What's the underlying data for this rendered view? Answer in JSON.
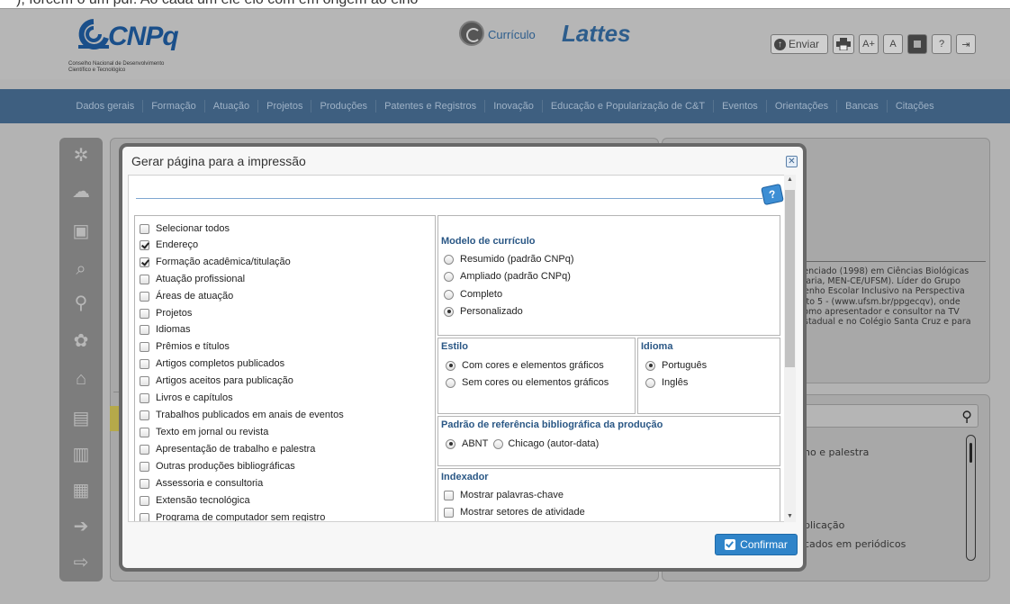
{
  "top_strip_text": "), forcem o um pdf: Ao cada um ele elo com em origem ao elno",
  "header": {
    "brand": "CNPq",
    "brand_sub1": "Conselho Nacional de Desenvolvimento",
    "brand_sub2": "Científico e Tecnológico",
    "lattes_prefix": "Currículo",
    "lattes_main": "Lattes",
    "toolbar": {
      "send_label": "Enviar",
      "font_increase": "A+",
      "font_normal": "A",
      "help": "?"
    }
  },
  "nav": [
    "Dados gerais",
    "Formação",
    "Atuação",
    "Projetos",
    "Produções",
    "Patentes e Registros",
    "Inovação",
    "Educação e Popularização de C&T",
    "Eventos",
    "Orientações",
    "Bancas",
    "Citações"
  ],
  "background": {
    "bio_lines": [
      "cenciado (1998) em Ciências Biológicas",
      " Maria, MEN-CE/UFSM). Líder do Grupo",
      "penho Escolar Inclusivo na Perspectiva",
      "eito 5 - (www.ufsm.br/ppgecqv), onde",
      " como apresentador e consultor na TV",
      "Estadual e no Colégio Santa Cruz e para"
    ],
    "list": [
      "ho e palestra",
      "blicação",
      "cados em periódicos"
    ]
  },
  "modal": {
    "title": "Gerar página para a impressão",
    "sections_list": [
      {
        "label": "Selecionar todos",
        "checked": false
      },
      {
        "label": "Endereço",
        "checked": true
      },
      {
        "label": "Formação acadêmica/titulação",
        "checked": true
      },
      {
        "label": "Atuação profissional",
        "checked": false
      },
      {
        "label": "Áreas de atuação",
        "checked": false
      },
      {
        "label": "Projetos",
        "checked": false
      },
      {
        "label": "Idiomas",
        "checked": false
      },
      {
        "label": "Prêmios e títulos",
        "checked": false
      },
      {
        "label": "Artigos completos publicados",
        "checked": false
      },
      {
        "label": "Artigos aceitos para publicação",
        "checked": false
      },
      {
        "label": "Livros e capítulos",
        "checked": false
      },
      {
        "label": "Trabalhos publicados em anais de eventos",
        "checked": false
      },
      {
        "label": "Texto em jornal ou revista",
        "checked": false
      },
      {
        "label": "Apresentação de trabalho e palestra",
        "checked": false
      },
      {
        "label": "Outras produções bibliográficas",
        "checked": false
      },
      {
        "label": "Assessoria e consultoria",
        "checked": false
      },
      {
        "label": "Extensão tecnológica",
        "checked": false
      },
      {
        "label": "Programa de computador sem registro",
        "checked": false
      }
    ],
    "modelo": {
      "title": "Modelo de currículo",
      "options": [
        "Resumido (padrão CNPq)",
        "Ampliado (padrão CNPq)",
        "Completo",
        "Personalizado"
      ],
      "selected": "Personalizado"
    },
    "estilo": {
      "title": "Estilo",
      "options": [
        "Com cores e elementos gráficos",
        "Sem cores ou elementos gráficos"
      ],
      "selected": "Com cores e elementos gráficos"
    },
    "idioma": {
      "title": "Idioma",
      "options": [
        "Português",
        "Inglês"
      ],
      "selected": "Português"
    },
    "referencia": {
      "title": "Padrão de referência bibliográfica da produção",
      "options": [
        "ABNT",
        "Chicago (autor-data)"
      ],
      "selected": "ABNT"
    },
    "indexador": {
      "title": "Indexador",
      "options": [
        {
          "label": "Mostrar palavras-chave",
          "checked": false
        },
        {
          "label": "Mostrar setores de atividade",
          "checked": false
        }
      ]
    },
    "confirm_label": "Confirmar"
  }
}
